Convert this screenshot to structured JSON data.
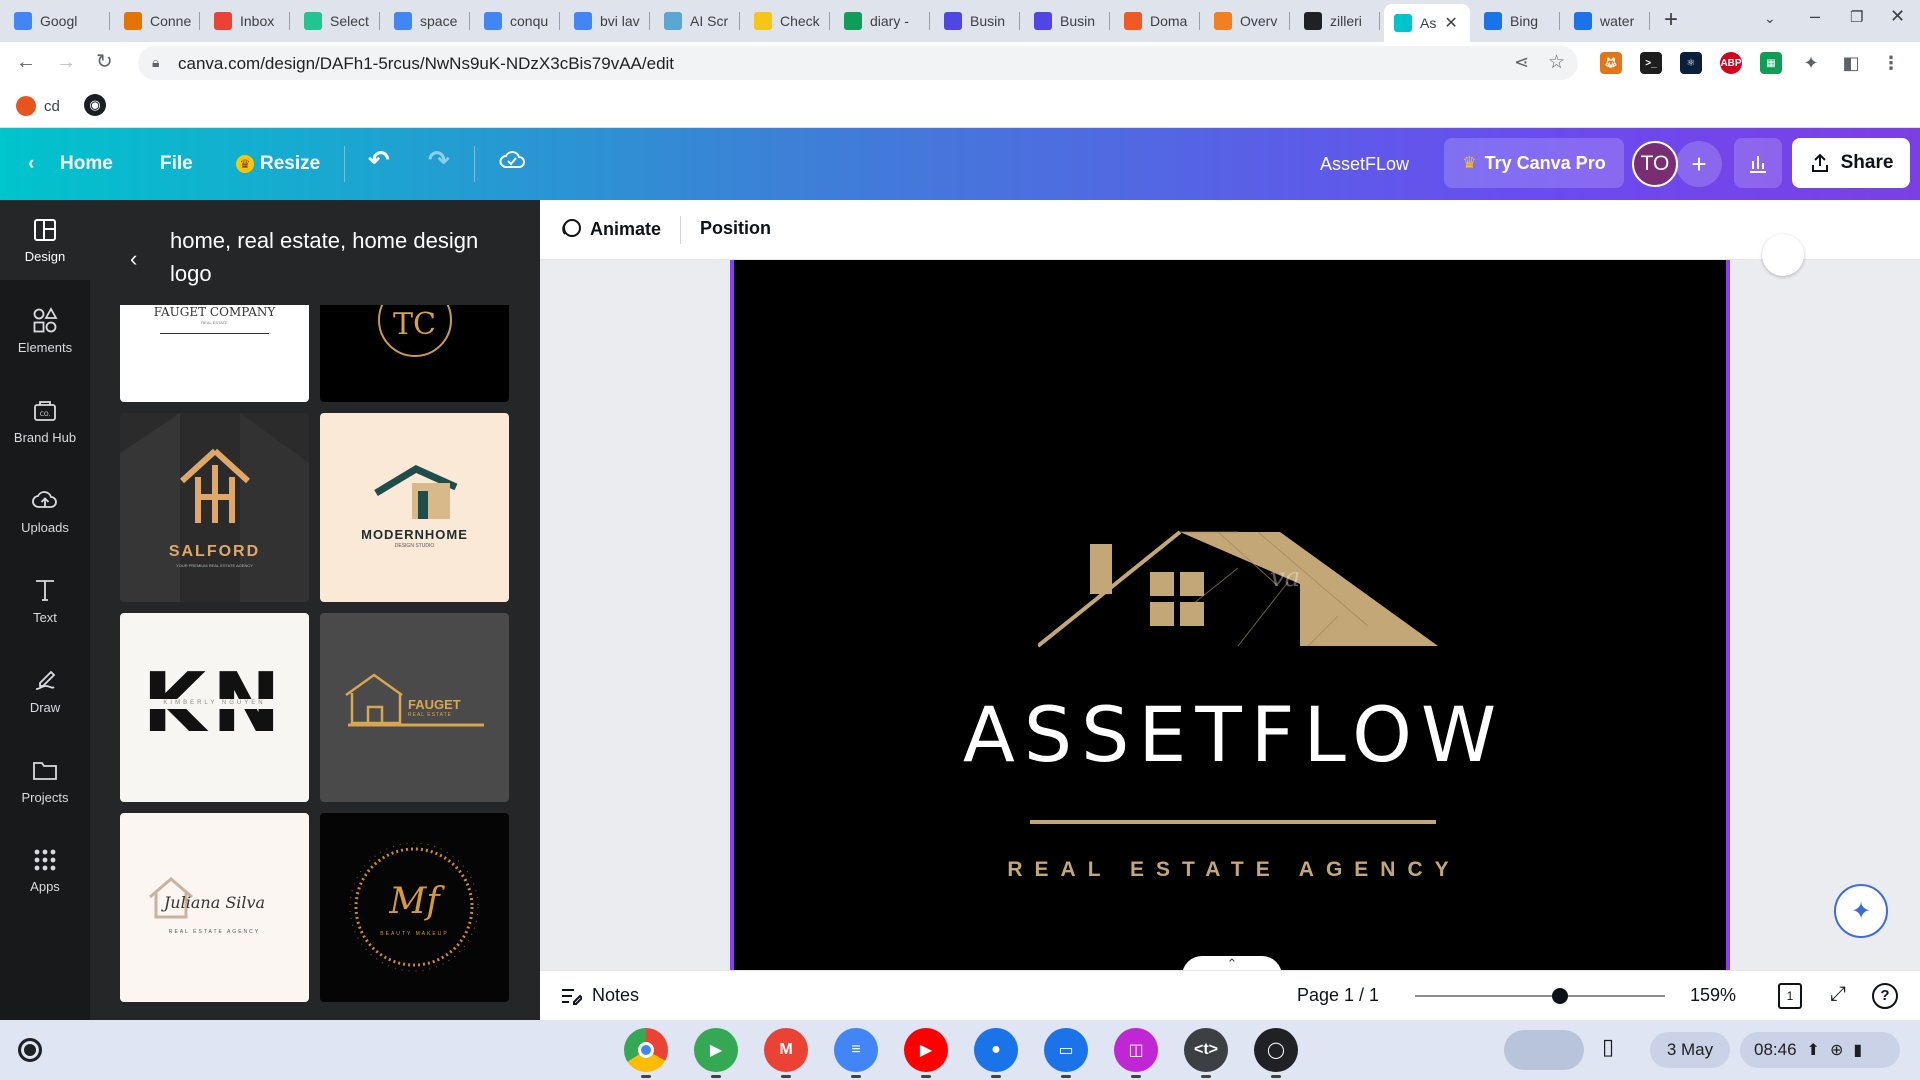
{
  "browser": {
    "tabs": [
      {
        "label": "Googl",
        "color": "#4285f4"
      },
      {
        "label": "Conne",
        "color": "#e37400"
      },
      {
        "label": "Inbox",
        "color": "#ea4335"
      },
      {
        "label": "Select",
        "color": "#22c58f"
      },
      {
        "label": "space",
        "color": "#4285f4"
      },
      {
        "label": "conqu",
        "color": "#4285f4"
      },
      {
        "label": "bvi lav",
        "color": "#4285f4"
      },
      {
        "label": "AI Scr",
        "color": "#5aa7d6"
      },
      {
        "label": "Check",
        "color": "#f5c518"
      },
      {
        "label": "diary -",
        "color": "#0f9d58"
      },
      {
        "label": "Busin",
        "color": "#4f46e5"
      },
      {
        "label": "Busin",
        "color": "#4f46e5"
      },
      {
        "label": "Doma",
        "color": "#ef5a24"
      },
      {
        "label": "Overv",
        "color": "#f38020"
      },
      {
        "label": "zilleri",
        "color": "#202124"
      },
      {
        "label": "As",
        "color": "#00c4cc"
      },
      {
        "label": "Bing",
        "color": "#1a73e8"
      },
      {
        "label": "water",
        "color": "#1a73e8"
      }
    ],
    "active_tab_index": 15,
    "url": "canva.com/design/DAFh1-5rcus/NwNs9uK-NDzX3cBis79vAA/edit",
    "bookmarks": [
      {
        "label": "cd"
      },
      {
        "label": ""
      }
    ]
  },
  "canva": {
    "header": {
      "home": "Home",
      "file": "File",
      "resize": "Resize",
      "doc_title": "AssetFLow",
      "try_pro": "Try Canva Pro",
      "avatar_initials": "TO",
      "share": "Share"
    },
    "rail": [
      {
        "label": "Design",
        "icon": "design-icon"
      },
      {
        "label": "Elements",
        "icon": "elements-icon"
      },
      {
        "label": "Brand Hub",
        "icon": "brand-hub-icon"
      },
      {
        "label": "Uploads",
        "icon": "upload-cloud-icon"
      },
      {
        "label": "Text",
        "icon": "text-icon"
      },
      {
        "label": "Draw",
        "icon": "draw-icon"
      },
      {
        "label": "Projects",
        "icon": "folder-icon"
      },
      {
        "label": "Apps",
        "icon": "apps-grid-icon"
      }
    ],
    "panel": {
      "title": "home, real estate, home design logo",
      "templates": [
        {
          "name": "faugetcompany",
          "text": "FAUGET COMPANY",
          "sub": "REAL ESTATE",
          "bg": "#ffffff"
        },
        {
          "name": "tc-monogram",
          "text": "TC",
          "sub": "",
          "bg": "#000000"
        },
        {
          "name": "salford",
          "text": "SALFORD",
          "sub": "YOUR PREMIUM REAL ESTATE AGENCY",
          "bg": "#2b2b2b"
        },
        {
          "name": "modernhome",
          "text": "MODERNHOME",
          "sub": "DESIGN STUDIO",
          "bg": "#fbe9d7"
        },
        {
          "name": "kn-monogram",
          "text": "KN",
          "sub": "KIMBERLY NGUYEN",
          "bg": "#f7f6f2"
        },
        {
          "name": "fauget-realestate",
          "text": "FAUGET",
          "sub": "REAL ESTATE",
          "bg": "#4a4a4a"
        },
        {
          "name": "juliana-silva",
          "text": "Juliana Silva",
          "sub": "REAL ESTATE AGENCY",
          "bg": "#fbf6f1"
        },
        {
          "name": "mf-monogram",
          "text": "Mf",
          "sub": "BEAUTY MAKEUP",
          "bg": "#050505"
        }
      ]
    },
    "context_toolbar": {
      "animate": "Animate",
      "position": "Position"
    },
    "design": {
      "brand": "ASSETFLOW",
      "tagline": "REAL ESTATE AGENCY",
      "watermark": "va",
      "gold": "#c4a776",
      "background": "#000000"
    },
    "footer": {
      "notes": "Notes",
      "page_indicator": "Page 1 / 1",
      "zoom": "159%",
      "zoom_level_fraction": 0.58,
      "page_count_badge": "1",
      "help": "?"
    }
  },
  "shelf": {
    "date": "3 May",
    "time": "08:46",
    "apps": [
      {
        "name": "chrome",
        "color": "#4285f4",
        "glyph": ""
      },
      {
        "name": "play-store",
        "color": "#34a853",
        "glyph": "▶"
      },
      {
        "name": "gmail",
        "color": "#ea4335",
        "glyph": "M"
      },
      {
        "name": "docs",
        "color": "#4285f4",
        "glyph": "≡"
      },
      {
        "name": "youtube",
        "color": "#ff0000",
        "glyph": "▶"
      },
      {
        "name": "messages",
        "color": "#1a73e8",
        "glyph": "●"
      },
      {
        "name": "files",
        "color": "#1a73e8",
        "glyph": "▭"
      },
      {
        "name": "canva",
        "color": "#c026d3",
        "glyph": "◫"
      },
      {
        "name": "terminal",
        "color": "#3c4043",
        "glyph": "<t>"
      },
      {
        "name": "camera",
        "color": "#202124",
        "glyph": "◯"
      }
    ]
  }
}
